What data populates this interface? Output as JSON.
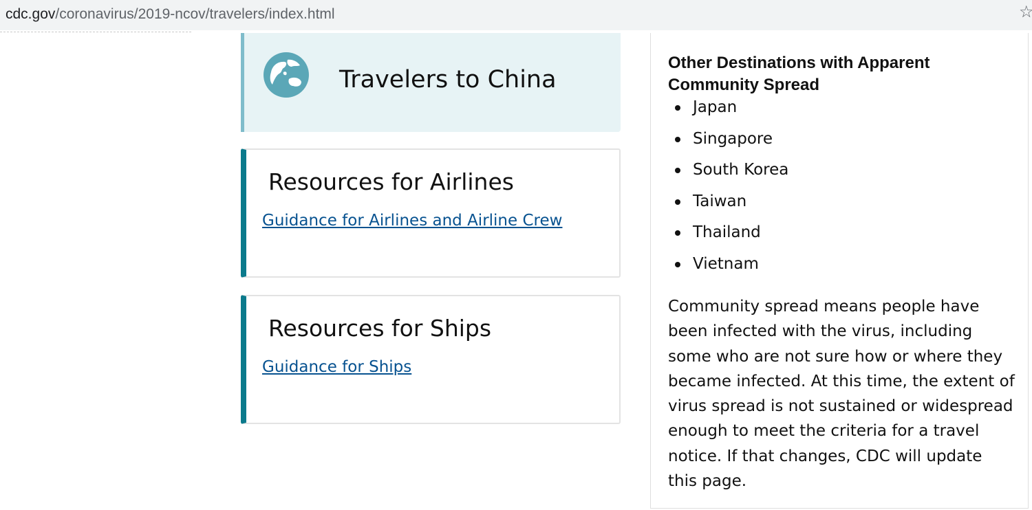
{
  "browser": {
    "url_domain": "cdc.gov",
    "url_path": "/coronavirus/2019-ncov/travelers/index.html",
    "bookmark_icon": "star-icon"
  },
  "cards": {
    "china": {
      "icon": "globe-icon",
      "icon_color": "#5ba7b7",
      "title": "Travelers to China"
    },
    "airlines": {
      "title": "Resources for Airlines",
      "link": "Guidance for Airlines and Airline Crew"
    },
    "ships": {
      "title": "Resources for Ships",
      "link": "Guidance for Ships"
    }
  },
  "sidebar": {
    "heading": "Other Destinations with Apparent Community Spread",
    "destinations": [
      "Japan",
      "Singapore",
      "South Korea",
      "Taiwan",
      "Thailand",
      "Vietnam"
    ],
    "description": "Community spread means people have been infected with the virus, including some who are not sure how or where they became infected. At this time, the extent of virus spread is not sustained or widespread enough to meet the criteria for a travel notice. If that changes, CDC will update this page."
  },
  "colors": {
    "accent": "#0b7a8c",
    "link": "#075290",
    "china_card_bg": "#e7f3f5"
  }
}
